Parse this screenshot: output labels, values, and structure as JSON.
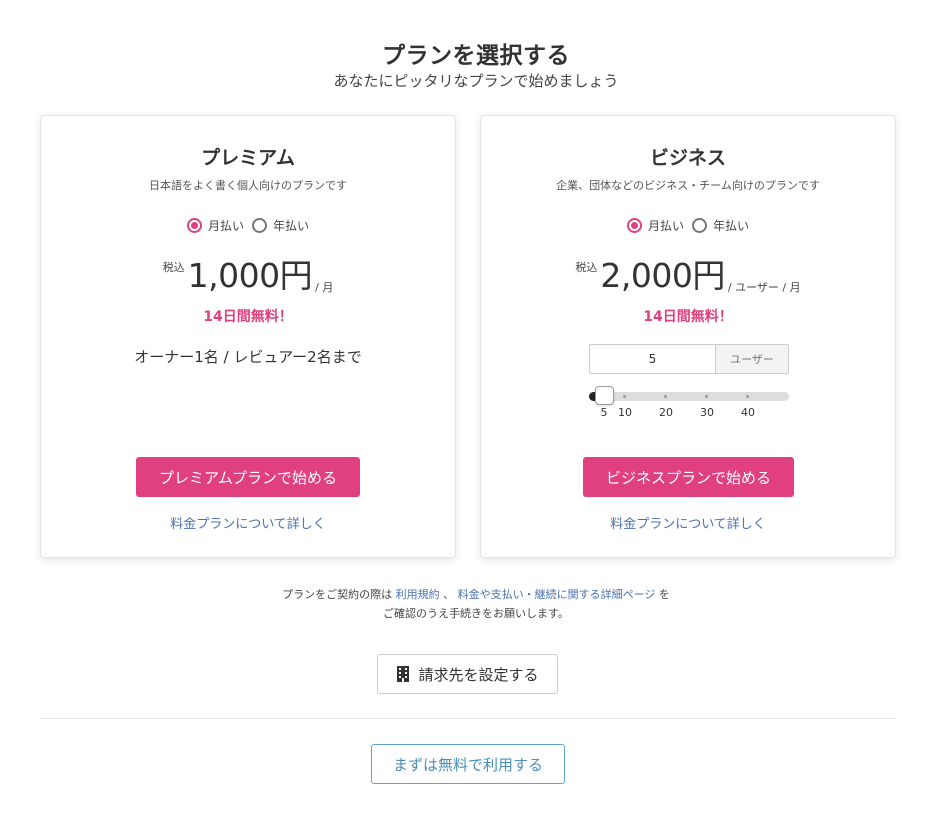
{
  "header": {
    "title": "プランを選択する",
    "subtitle": "あなたにピッタリなプランで始めましょう"
  },
  "plans": [
    {
      "name": "プレミアム",
      "description": "日本語をよく書く個人向けのプランです",
      "billing_options": [
        "月払い",
        "年払い"
      ],
      "billing_selected": "月払い",
      "tax_label": "税込",
      "price": "1,000円",
      "per": "/ 月",
      "trial": "14日間無料！",
      "limit": "オーナー1名 / レビュアー2名まで",
      "cta": "プレミアムプランで始める",
      "details_link": "料金プランについて詳しく"
    },
    {
      "name": "ビジネス",
      "description": "企業、団体などのビジネス・チーム向けのプランです",
      "billing_options": [
        "月払い",
        "年払い"
      ],
      "billing_selected": "月払い",
      "tax_label": "税込",
      "price": "2,000円",
      "per": "/ ユーザー / 月",
      "trial": "14日間無料！",
      "users_value": "5",
      "users_unit": "ユーザー",
      "slider": {
        "value": 5,
        "min": 5,
        "max": 50,
        "tick_labels": [
          "5",
          "10",
          "20",
          "30",
          "40"
        ]
      },
      "cta": "ビジネスプランで始める",
      "details_link": "料金プランについて詳しく"
    }
  ],
  "terms": {
    "prefix": "プランをご契約の際は",
    "link1": "利用規約",
    "sep": "、",
    "link2": "料金や支払い・継続に関する詳細ページ",
    "suffix": "を",
    "line2": "ご確認のうえ手続きをお願いします。"
  },
  "billing_button": {
    "label": "請求先を設定する",
    "icon": "building-icon"
  },
  "free_button": {
    "label": "まずは無料で利用する"
  },
  "colors": {
    "accent": "#e0407f",
    "link": "#4a72b0",
    "secondary_border": "#5fa3c8"
  }
}
